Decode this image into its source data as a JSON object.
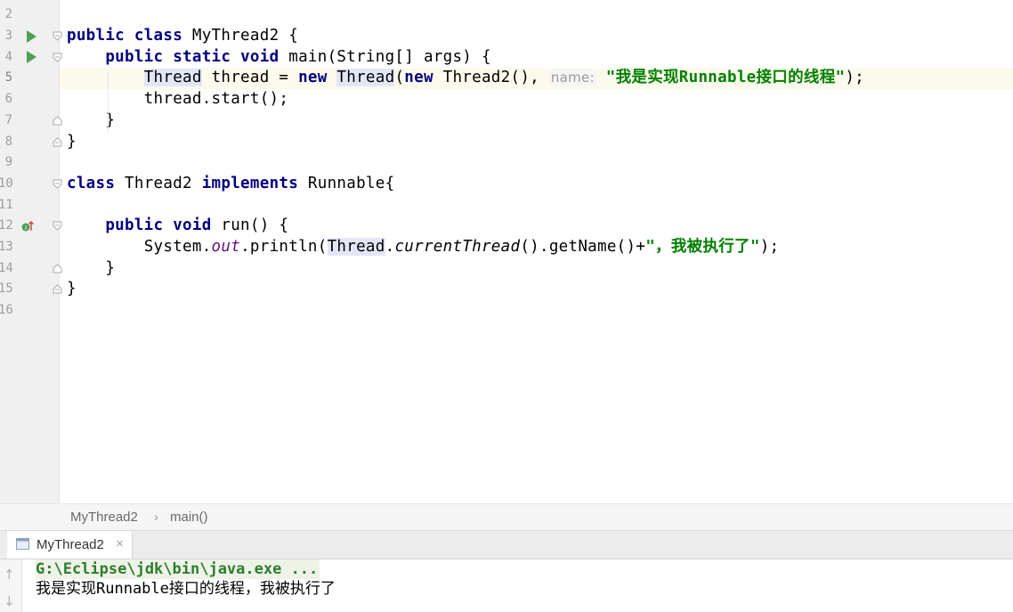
{
  "editor": {
    "line_numbers": [
      "2",
      "3",
      "4",
      "5",
      "6",
      "7",
      "8",
      "9",
      "10",
      "11",
      "12",
      "13",
      "14",
      "15",
      "16"
    ],
    "line3": {
      "kw1": "public",
      "kw2": "class",
      "rest": " MyThread2 {"
    },
    "line4": {
      "indent": "    ",
      "kw1": "public",
      "kw2": "static",
      "kw3": "void",
      "rest": " main(String[] args) {"
    },
    "line5": {
      "indent": "        ",
      "type1": "Thread",
      "mid": " thread = ",
      "kw_new": "new",
      "type2": "Thread",
      "paren": "(",
      "kw_new2": "new",
      "rest": " Thread2(), ",
      "hint": "name:",
      "str": "\"我是实现Runnable接口的线程\"",
      "end": ");"
    },
    "line6": {
      "text": "        thread.start();"
    },
    "line7": {
      "text": "    }"
    },
    "line8": {
      "text": "}"
    },
    "line10": {
      "kw1": "class",
      "mid": " Thread2 ",
      "kw2": "implements",
      "rest": " Runnable{"
    },
    "line12": {
      "indent": "    ",
      "kw1": "public",
      "kw2": "void",
      "rest": " run() {"
    },
    "line13": {
      "indent": "        ",
      "a": "System.",
      "field": "out",
      "b": ".println(",
      "type": "Thread",
      "dot": ".",
      "method": "currentThread",
      "c": "().getName()+",
      "str": "\"，我被执行了\"",
      "end": ");"
    },
    "line14": {
      "text": "    }"
    },
    "line15": {
      "text": "}"
    }
  },
  "breadcrumb": {
    "class_name": "MyThread2",
    "separator": "›",
    "method": "main()"
  },
  "run_panel": {
    "tab_label": "MyThread2",
    "tab_close": "×",
    "command": "G:\\Eclipse\\jdk\\bin\\java.exe ...",
    "output": "我是实现Runnable接口的线程，我被执行了",
    "arrow_up": "↑",
    "arrow_down": "↓"
  },
  "colors": {
    "keyword": "#000080",
    "string": "#008000",
    "run_icon": "#4fa053",
    "current_line": "#fcfaed"
  },
  "icons": [
    "run-icon",
    "fold-icon",
    "implements-icon",
    "console-tab-icon",
    "close-icon",
    "scroll-up-icon",
    "scroll-down-icon"
  ]
}
